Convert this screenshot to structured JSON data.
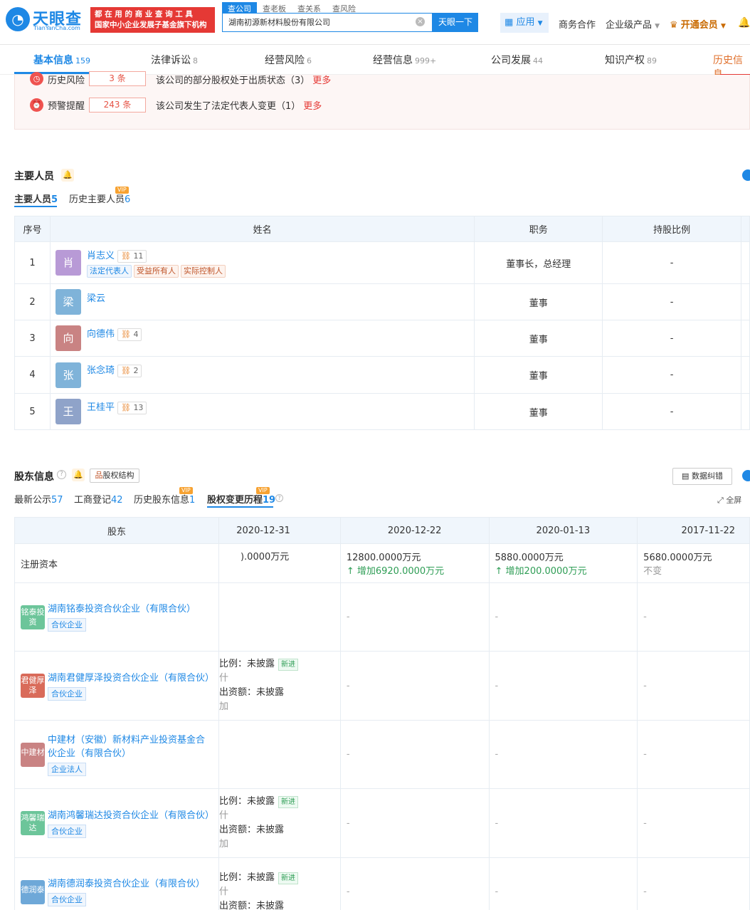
{
  "header": {
    "logo_text": "天眼查",
    "logo_sub": "TianYanCha.com",
    "slogan_line1": "都 在 用 的 商 业 查 询 工 具",
    "slogan_line2": "国家中小企业发展子基金旗下机构",
    "search_tabs": [
      "查公司",
      "查老板",
      "查关系",
      "查风险"
    ],
    "search_value": "湖南初源新材料股份有限公司",
    "search_button": "天眼一下",
    "app_label": "应用",
    "nav": [
      "商务合作",
      "企业级产品",
      "开通会员"
    ]
  },
  "tabs": [
    {
      "label": "基本信息",
      "count": "159"
    },
    {
      "label": "法律诉讼",
      "count": "8"
    },
    {
      "label": "经营风险",
      "count": "6"
    },
    {
      "label": "经营信息",
      "count": "999+"
    },
    {
      "label": "公司发展",
      "count": "44"
    },
    {
      "label": "知识产权",
      "count": "89"
    },
    {
      "label": "历史信息",
      "count": ""
    }
  ],
  "risk": [
    {
      "label": "历史风险",
      "count": "3 条",
      "desc": "该公司的部分股权处于出质状态（3）",
      "more": "更多"
    },
    {
      "label": "预警提醒",
      "count": "243 条",
      "desc": "该公司发生了法定代表人变更（1）",
      "more": "更多"
    }
  ],
  "people": {
    "title": "主要人员",
    "subtabs": [
      {
        "label": "主要人员",
        "count": "5"
      },
      {
        "label": "历史主要人员",
        "count": "6",
        "vip": "VIP"
      }
    ],
    "columns": [
      "序号",
      "姓名",
      "职务",
      "持股比例"
    ],
    "rows": [
      {
        "no": "1",
        "avatar": "肖",
        "color": "#b89ad6",
        "name": "肖志义",
        "rel": "11",
        "tags": [
          "法定代表人",
          "受益所有人",
          "实际控制人"
        ],
        "title": "董事长，总经理",
        "ratio": "-"
      },
      {
        "no": "2",
        "avatar": "梁",
        "color": "#7fb3d9",
        "name": "梁云",
        "rel": "",
        "tags": [],
        "title": "董事",
        "ratio": "-"
      },
      {
        "no": "3",
        "avatar": "向",
        "color": "#c98383",
        "name": "向德伟",
        "rel": "4",
        "tags": [],
        "title": "董事",
        "ratio": "-"
      },
      {
        "no": "4",
        "avatar": "张",
        "color": "#7fb3d9",
        "name": "张念琦",
        "rel": "2",
        "tags": [],
        "title": "董事",
        "ratio": "-"
      },
      {
        "no": "5",
        "avatar": "王",
        "color": "#8fa3c9",
        "name": "王桂平",
        "rel": "13",
        "tags": [],
        "title": "董事",
        "ratio": "-"
      }
    ]
  },
  "shareholders": {
    "title": "股东信息",
    "structure_btn": "股权结构",
    "error_btn": "数据纠错",
    "fullscreen": "全屏",
    "subtabs": [
      {
        "label": "最新公示",
        "count": "57"
      },
      {
        "label": "工商登记",
        "count": "42"
      },
      {
        "label": "历史股东信息",
        "count": "1",
        "vip": "VIP"
      },
      {
        "label": "股权变更历程",
        "count": "19",
        "vip": "VIP"
      }
    ],
    "columns": [
      "股东",
      "2020-12-31",
      "2020-12-22",
      "2020-01-13",
      "2017-11-22"
    ],
    "capital_label": "注册资本",
    "capital": [
      {
        "value": ").0000万元",
        "change": ""
      },
      {
        "value": "12800.0000万元",
        "change": "增加6920.0000万元"
      },
      {
        "value": "5880.0000万元",
        "change": "增加200.0000万元"
      },
      {
        "value": "5680.0000万元",
        "change": "不变"
      }
    ],
    "dash": "-",
    "rows": [
      {
        "logo": "铭泰投资",
        "color": "#6cc59a",
        "name": "湖南铭泰投资合伙企业（有限合伙）",
        "tag": "合伙企业",
        "ratio_label": "",
        "ratio_value": "",
        "new_tag": "",
        "line2": "",
        "amount_label": "",
        "amount_value": "",
        "line4": ""
      },
      {
        "logo": "君健厚泽",
        "color": "#d96b5a",
        "name": "湖南君健厚泽投资合伙企业（有限合伙）",
        "tag": "合伙企业",
        "ratio_label": "比例：",
        "ratio_value": "未披露",
        "new_tag": "新进",
        "line2": "什",
        "amount_label": "出资额：",
        "amount_value": "未披露",
        "line4": "加"
      },
      {
        "logo": "中建材",
        "color": "#c98383",
        "name": "中建材（安徽）新材料产业投资基金合伙企业（有限合伙）",
        "tag": "企业法人",
        "ratio_label": "",
        "ratio_value": "",
        "new_tag": "",
        "line2": "",
        "amount_label": "",
        "amount_value": "",
        "line4": ""
      },
      {
        "logo": "鸿馨瑞达",
        "color": "#6cc59a",
        "name": "湖南鸿馨瑞达投资合伙企业（有限合伙）",
        "tag": "合伙企业",
        "ratio_label": "比例：",
        "ratio_value": "未披露",
        "new_tag": "新进",
        "line2": "什",
        "amount_label": "出资额：",
        "amount_value": "未披露",
        "line4": "加"
      },
      {
        "logo": "德润泰",
        "color": "#6ea8d8",
        "name": "湖南德润泰投资合伙企业（有限合伙）",
        "tag": "合伙企业",
        "ratio_label": "比例：",
        "ratio_value": "未披露",
        "new_tag": "新进",
        "line2": "什",
        "amount_label": "出资额：",
        "amount_value": "未披露",
        "line4": ""
      }
    ]
  }
}
